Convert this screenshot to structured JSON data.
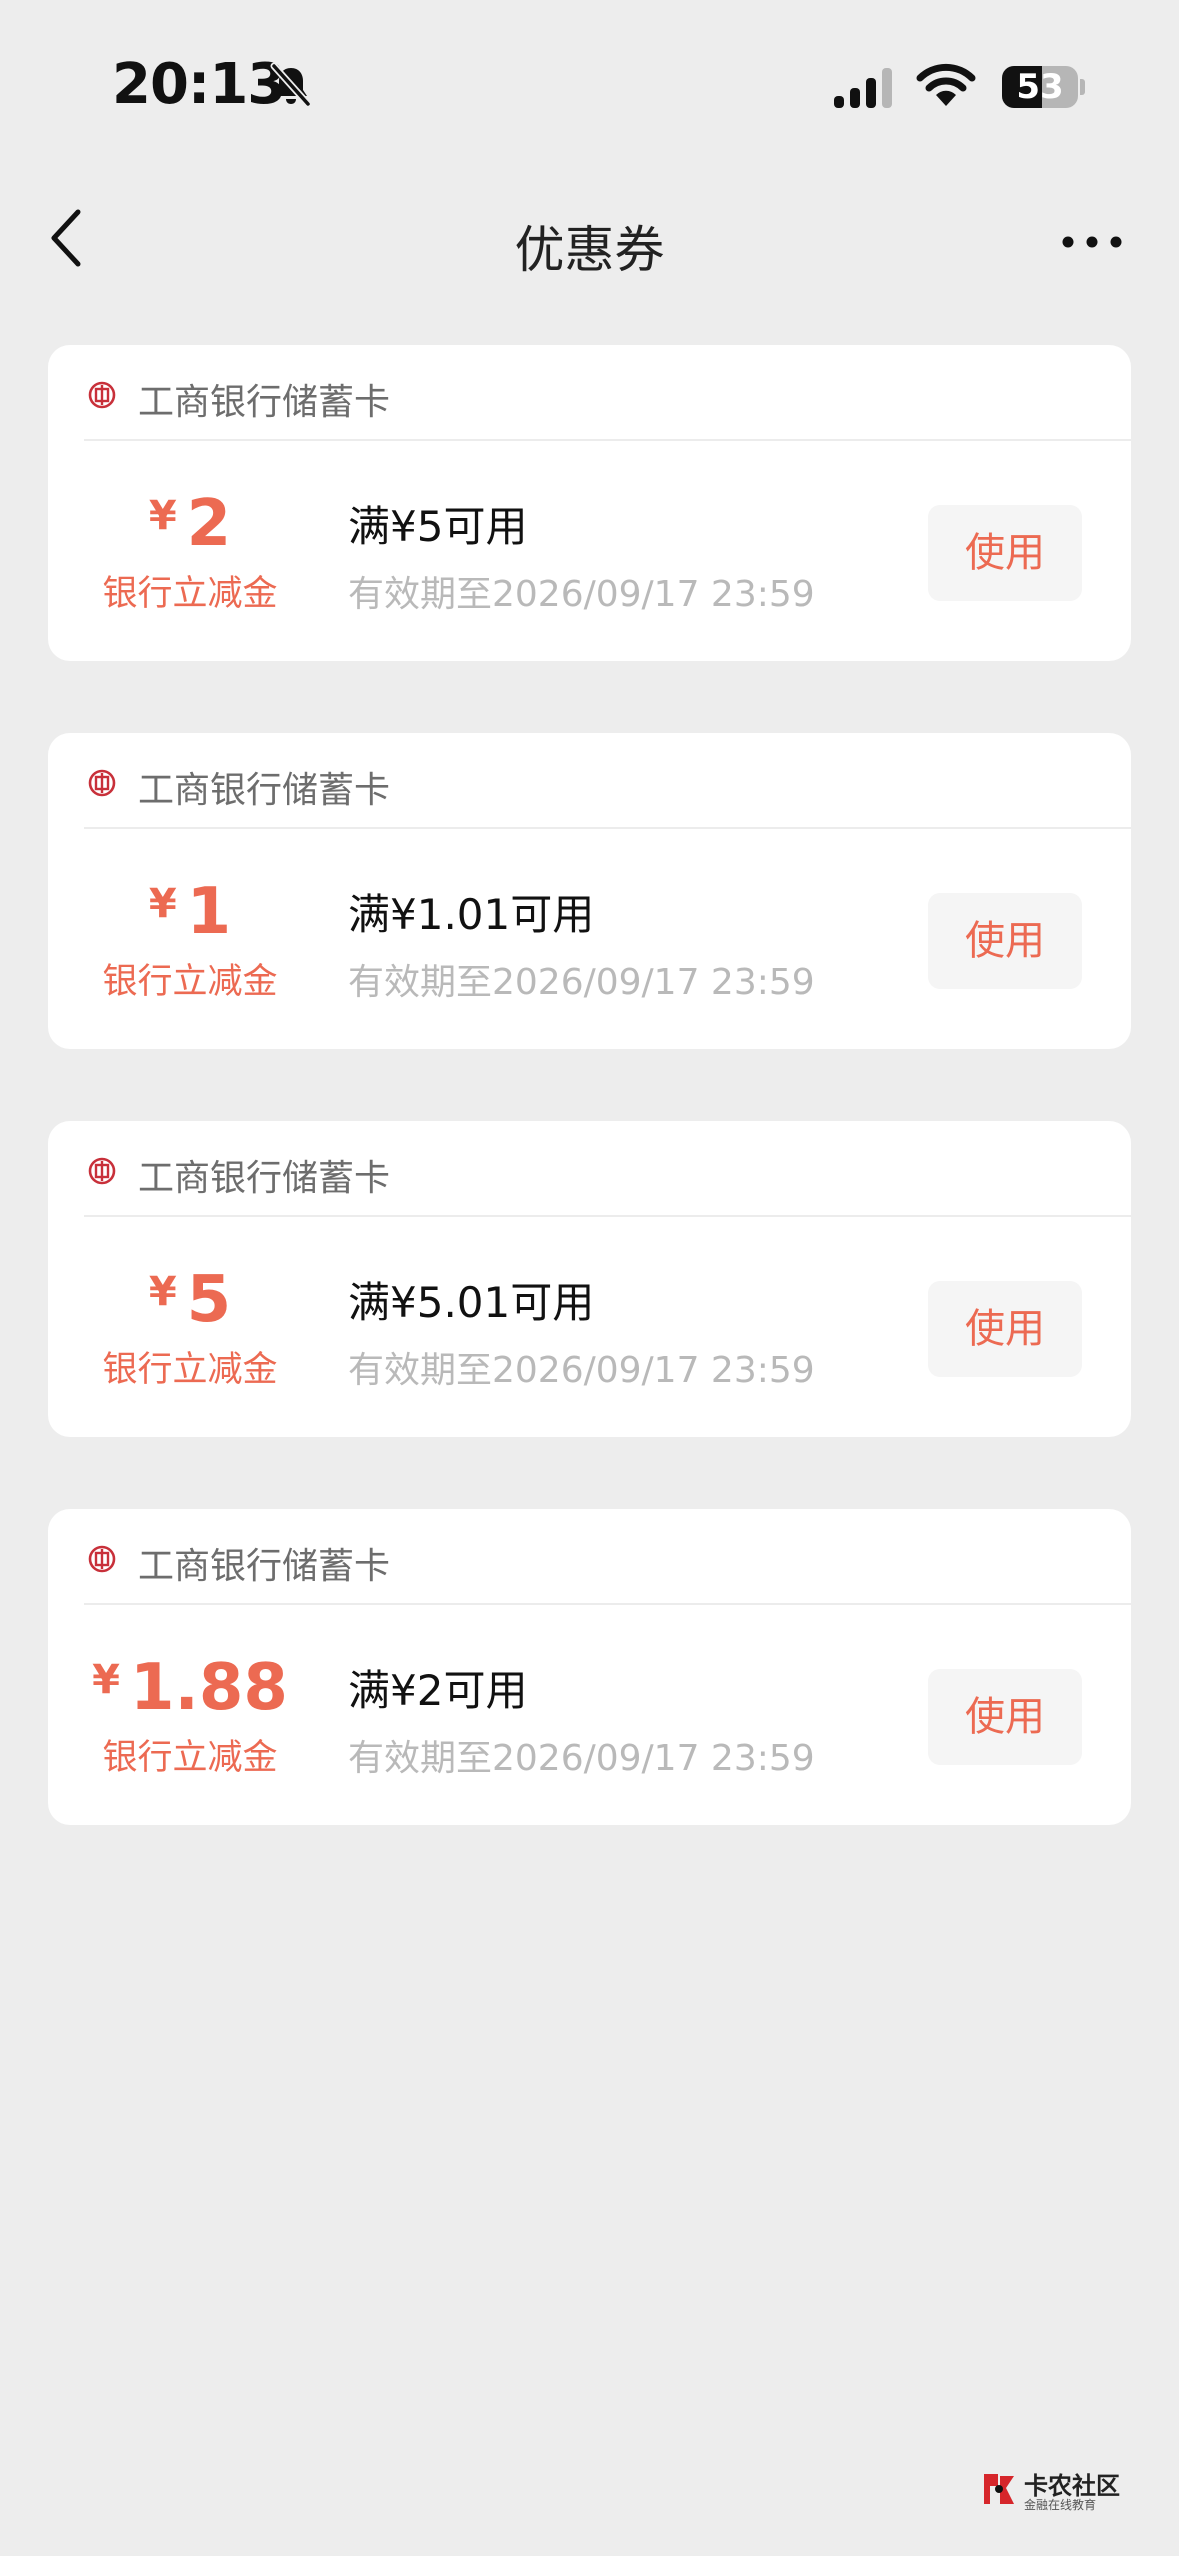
{
  "status_bar": {
    "time": "20:13",
    "battery_level": "53",
    "icons": [
      "bell-muted-icon",
      "signal-icon",
      "wifi-icon",
      "battery-icon"
    ]
  },
  "nav": {
    "title": "优惠券",
    "back_icon": "chevron-left-icon",
    "more_icon": "more-horizontal-icon"
  },
  "colors": {
    "accent": "#ec6a52",
    "background": "#ededed",
    "card": "#ffffff",
    "muted_text": "#b9b9b9",
    "bank_icon": "#c8303a"
  },
  "coupons": [
    {
      "bank": "工商银行储蓄卡",
      "currency": "¥",
      "amount": "2",
      "amount_label": "银行立减金",
      "condition": "满¥5可用",
      "validity": "有效期至2026/09/17 23:59",
      "button_label": "使用"
    },
    {
      "bank": "工商银行储蓄卡",
      "currency": "¥",
      "amount": "1",
      "amount_label": "银行立减金",
      "condition": "满¥1.01可用",
      "validity": "有效期至2026/09/17 23:59",
      "button_label": "使用"
    },
    {
      "bank": "工商银行储蓄卡",
      "currency": "¥",
      "amount": "5",
      "amount_label": "银行立减金",
      "condition": "满¥5.01可用",
      "validity": "有效期至2026/09/17 23:59",
      "button_label": "使用"
    },
    {
      "bank": "工商银行储蓄卡",
      "currency": "¥",
      "amount": "1.88",
      "amount_label": "银行立减金",
      "condition": "满¥2可用",
      "validity": "有效期至2026/09/17 23:59",
      "button_label": "使用"
    }
  ],
  "watermark": {
    "title": "卡农社区",
    "subtitle": "金融在线教育"
  }
}
